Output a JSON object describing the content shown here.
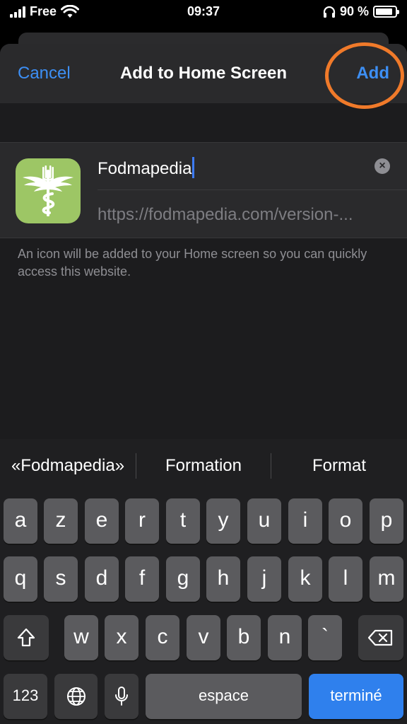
{
  "status": {
    "carrier": "Free",
    "time": "09:37",
    "battery": "90 %",
    "battery_level": 0.9
  },
  "sheet": {
    "cancel_label": "Cancel",
    "title": "Add to Home Screen",
    "add_label": "Add"
  },
  "form": {
    "name_value": "Fodmapedia",
    "url_value": "https://fodmapedia.com/version-...",
    "info": "An icon will be added to your Home screen so you can quickly access this website."
  },
  "keyboard": {
    "suggestions": [
      "«Fodmapedia»",
      "Formation",
      "Format"
    ],
    "row1": [
      "a",
      "z",
      "e",
      "r",
      "t",
      "y",
      "u",
      "i",
      "o",
      "p"
    ],
    "row2": [
      "q",
      "s",
      "d",
      "f",
      "g",
      "h",
      "j",
      "k",
      "l",
      "m"
    ],
    "row3": [
      "w",
      "x",
      "c",
      "v",
      "b",
      "n",
      "`"
    ],
    "numbers_label": "123",
    "space_label": "espace",
    "done_label": "terminé"
  },
  "colors": {
    "accent": "#3d8ff5",
    "highlight": "#f07a2a",
    "icon_bg": "#9dc665",
    "done_key": "#2f80ed"
  },
  "icons": [
    "signal-icon",
    "wifi-icon",
    "headphones-icon",
    "battery-icon",
    "clear-icon",
    "shift-icon",
    "backspace-icon",
    "globe-icon",
    "microphone-icon",
    "caduceus-icon"
  ]
}
